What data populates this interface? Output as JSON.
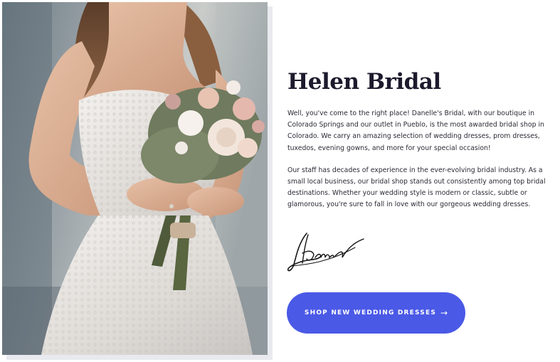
{
  "about": {
    "title": "Helen Bridal",
    "paragraph_1": "Well, you've come to the right place! Danelle's Bridal, with our boutique in Colorado Springs and our outlet in Pueblo, is the most awarded bridal shop in Colorado. We carry an amazing selection of wedding dresses, prom dresses, tuxedos, evening gowns, and more for your special occasion!",
    "paragraph_2": "Our staff has decades of experience in the ever-evolving bridal industry. As a small local business, our bridal shop stands out consistently among top bridal destinations. Whether your wedding style is modern or classic, subtle or glamorous, you're sure to fall in love with our gorgeous wedding dresses.",
    "signature": "Daniel",
    "cta_label": "SHOP NEW WEDDING DRESSES",
    "cta_arrow": "→"
  },
  "photo": {
    "subject": "bride holding bouquet"
  },
  "colors": {
    "heading": "#1c1a2c",
    "body_text": "#2a2a35",
    "button": "#4a59e6",
    "button_text": "#ffffff"
  }
}
